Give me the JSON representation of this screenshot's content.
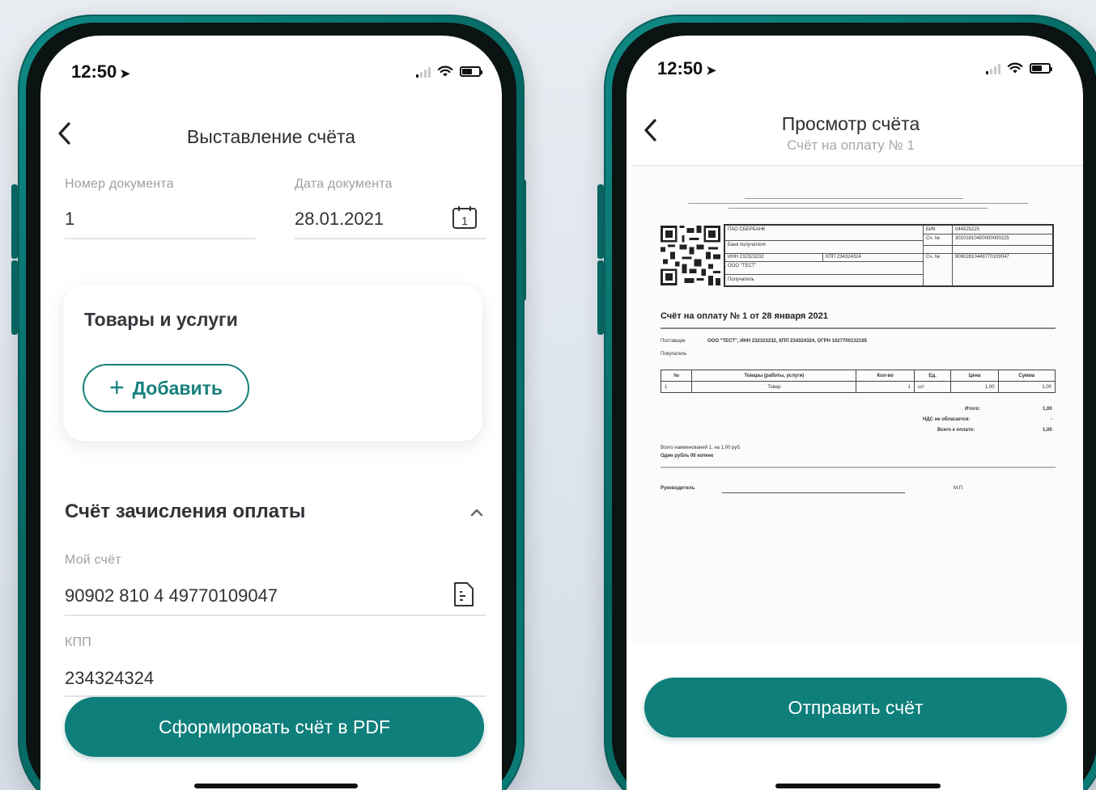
{
  "left_screen": {
    "status": {
      "time": "12:50"
    },
    "header": {
      "title": "Выставление счёта"
    },
    "fields": {
      "doc_number_label": "Номер документа",
      "doc_number_value": "1",
      "doc_date_label": "Дата документа",
      "doc_date_value": "28.01.2021",
      "calendar_day": "1"
    },
    "goods_card": {
      "title": "Товары и услуги",
      "add_label": "Добавить"
    },
    "payment_section": {
      "title": "Счёт зачисления оплаты",
      "account_label": "Мой счёт",
      "account_value": "90902 810 4 49770109047",
      "kpp_label": "КПП",
      "kpp_value": "234324324"
    },
    "primary_button": "Сформировать счёт в PDF"
  },
  "right_screen": {
    "status": {
      "time": "12:50"
    },
    "header": {
      "title": "Просмотр счёта",
      "subtitle": "Счёт на оплату № 1"
    },
    "document": {
      "bank_name": "ПАО СБЕРБАНК",
      "bank_recipient": "Банк получателя",
      "inn": "ИНН 232323232",
      "kpp": "КПП 234324324",
      "org": "ООО \"ТЕСТ\"",
      "recipient": "Получатель",
      "bik_label": "БИК",
      "bik_value": "044525225",
      "acc_label_1": "Сч. №",
      "acc_value_1": "30101810400000000225",
      "acc_label_2": "Сч. №",
      "acc_value_2": "90902810449770109047",
      "invoice_title": "Счёт на оплату № 1 от 28 января 2021",
      "supplier_label": "Поставщик",
      "supplier_value": "ООО \"ТЕСТ\", ИНН 232323232, КПП 234324324, ОГРН 1027700132195",
      "buyer_label": "Покупатель",
      "table_headers": [
        "№",
        "Товары (работы, услуги)",
        "Кол-во",
        "Ед.",
        "Цена",
        "Сумма"
      ],
      "table_rows": [
        [
          "1",
          "Товар",
          "1",
          "шт",
          "1,00",
          "1,00"
        ]
      ],
      "total_label": "Итого:",
      "total_value": "1,00",
      "vat_label": "НДС не облагается:",
      "vat_value": "-",
      "due_label": "Всего к оплате:",
      "due_value": "1,00",
      "summary_line": "Всего наименований 1, на 1,00 руб.",
      "summary_words": "Один рубль 00 копеек",
      "director_label": "Руководитель",
      "stamp_label": "М.П."
    },
    "primary_button": "Отправить счёт"
  }
}
